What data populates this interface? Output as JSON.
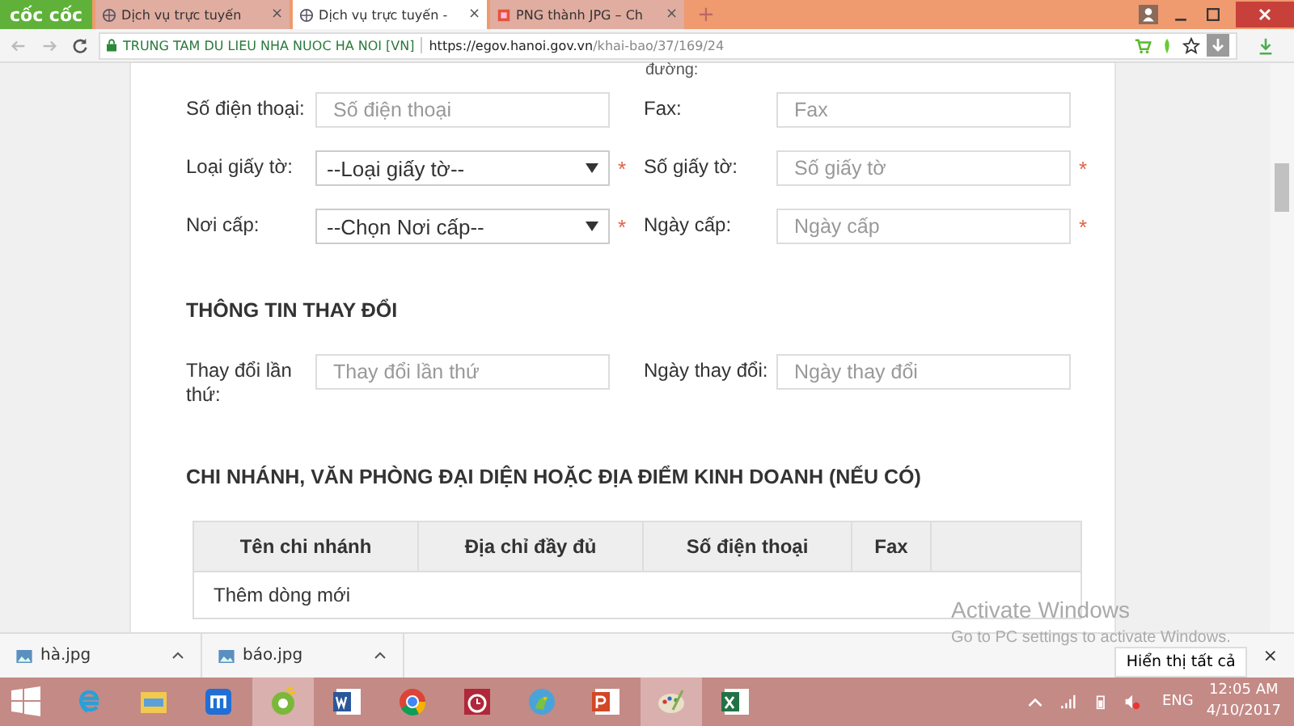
{
  "browser": {
    "brand": "cốc cốc",
    "tabs": [
      {
        "title": "Dịch vụ trực tuyến",
        "selected": false,
        "kind": "globe"
      },
      {
        "title": "Dịch vụ trực tuyến -",
        "selected": true,
        "kind": "globe"
      },
      {
        "title": "PNG thành JPG – Ch",
        "selected": false,
        "kind": "image"
      }
    ],
    "tab_close": "×",
    "new_tab": "+",
    "address": {
      "site": "TRUNG TAM DU LIEU NHA NUOC HA NOI [VN]",
      "url_host": "https://egov.hanoi.gov.vn",
      "url_path": "/khai-bao/37/169/24"
    }
  },
  "form": {
    "partial_label": "đường:",
    "rows": [
      {
        "fields": [
          {
            "label": "Số điện thoại:",
            "kind": "input",
            "placeholder": "Số điện thoại",
            "required": false
          },
          {
            "label": "Fax:",
            "kind": "input",
            "placeholder": "Fax",
            "required": false
          }
        ]
      },
      {
        "fields": [
          {
            "label": "Loại giấy tờ:",
            "kind": "select",
            "value": "--Loại giấy tờ--",
            "required": true
          },
          {
            "label": "Số giấy tờ:",
            "kind": "input",
            "placeholder": "Số giấy tờ",
            "required": true
          }
        ]
      },
      {
        "fields": [
          {
            "label": "Nơi cấp:",
            "kind": "select",
            "value": "--Chọn Nơi cấp--",
            "required": true
          },
          {
            "label": "Ngày cấp:",
            "kind": "input",
            "placeholder": "Ngày cấp",
            "required": true
          }
        ]
      }
    ],
    "required_mark": "*",
    "change_section": {
      "heading": "THÔNG TIN THAY ĐỔI",
      "fields": [
        {
          "label": "Thay đổi lần thứ:",
          "kind": "input",
          "placeholder": "Thay đổi lần thứ",
          "required": false
        },
        {
          "label": "Ngày thay đổi:",
          "kind": "input",
          "placeholder": "Ngày thay đổi",
          "required": false
        }
      ]
    },
    "branch_section": {
      "heading": "CHI NHÁNH, VĂN PHÒNG ĐẠI DIỆN HOẶC ĐỊA ĐIỂM KINH DOANH (NẾU CÓ)",
      "table": {
        "columns": [
          "Tên chi nhánh",
          "Địa chỉ đầy đủ",
          "Số điện thoại",
          "Fax"
        ],
        "add_row": "Thêm dòng mới"
      }
    }
  },
  "activation": {
    "title": "Activate Windows",
    "subtitle": "Go to PC settings to activate Windows."
  },
  "downloads": {
    "files": [
      "hà.jpg",
      "báo.jpg"
    ],
    "show_all": "Hiển thị tất cả",
    "close": "×"
  },
  "taskbar": {
    "apps": [
      {
        "kind": "ie",
        "selected": false
      },
      {
        "kind": "folder",
        "selected": false
      },
      {
        "kind": "maxthon",
        "selected": false
      },
      {
        "kind": "coccoc",
        "selected": true
      },
      {
        "kind": "word",
        "selected": false
      },
      {
        "kind": "chrome",
        "selected": false
      },
      {
        "kind": "alarm",
        "selected": false
      },
      {
        "kind": "parrot",
        "selected": false
      },
      {
        "kind": "powerpoint",
        "selected": false
      },
      {
        "kind": "paint",
        "selected": true
      },
      {
        "kind": "excel",
        "selected": false
      }
    ],
    "lang": "ENG",
    "time": "12:05 AM",
    "date": "4/10/2017"
  }
}
